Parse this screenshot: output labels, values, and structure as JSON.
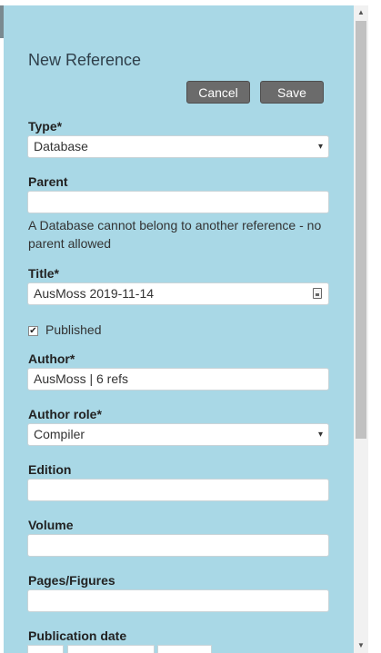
{
  "form": {
    "title": "New Reference",
    "cancel_label": "Cancel",
    "save_label": "Save",
    "type_label": "Type",
    "type_value": "Database",
    "parent_label": "Parent",
    "parent_value": "",
    "parent_help": "A Database cannot belong to another reference - no parent allowed",
    "title_label": "Title",
    "title_value": "AusMoss 2019-11-14",
    "published_label": "Published",
    "published_checked": true,
    "author_label": "Author",
    "author_value": "AusMoss | 6 refs",
    "author_role_label": "Author role",
    "author_role_value": "Compiler",
    "edition_label": "Edition",
    "edition_value": "",
    "volume_label": "Volume",
    "volume_value": "",
    "pages_label": "Pages/Figures",
    "pages_value": "",
    "pub_date_label": "Publication date",
    "required_mark": "*"
  },
  "icons": {
    "select_arrow": "▾",
    "checkmark": "✔",
    "scroll_up": "▲",
    "scroll_down": "▼",
    "calendar": "calendar-icon"
  }
}
